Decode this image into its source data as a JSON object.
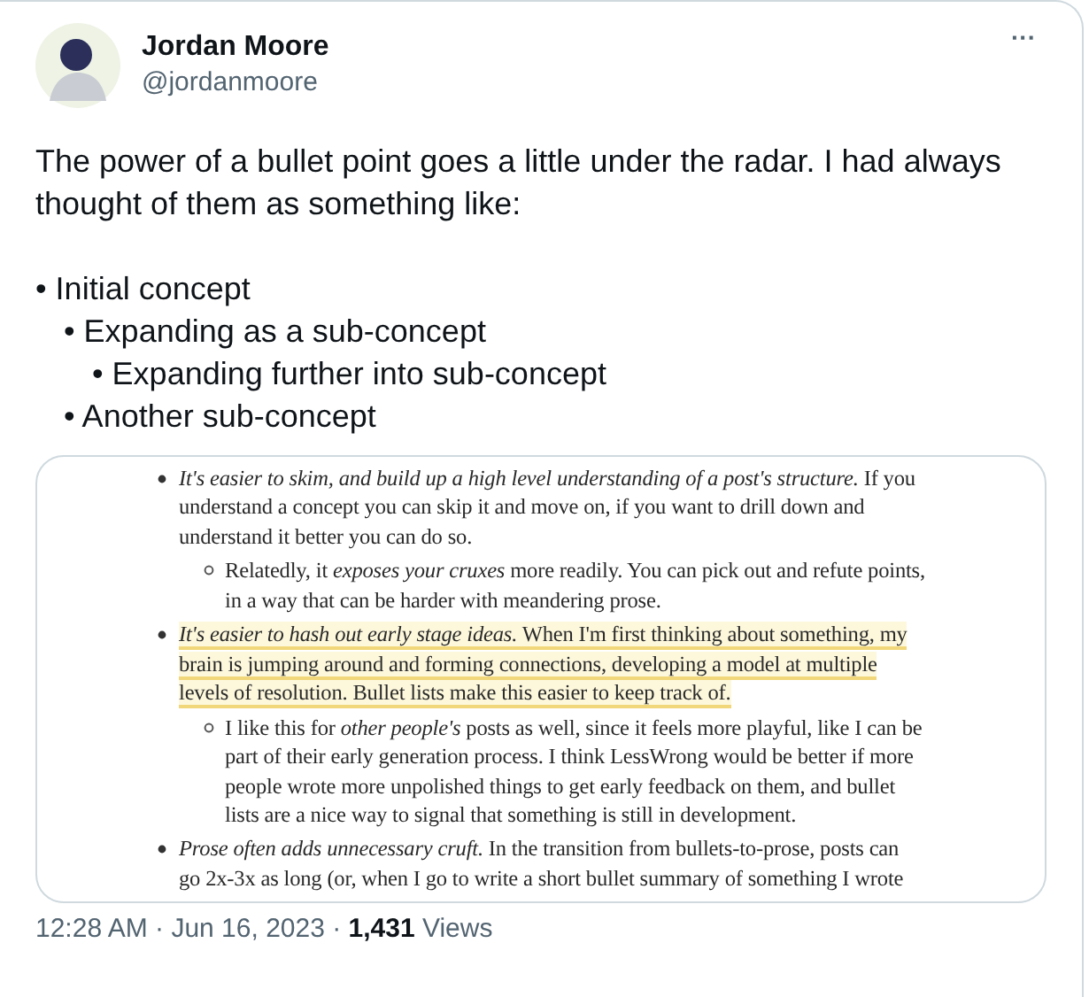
{
  "author": {
    "name": "Jordan Moore",
    "handle": "@jordanmoore"
  },
  "more_button": "···",
  "text": "The power of a bullet point goes a little under the radar. I had always thought of them as something like:",
  "bullets": [
    {
      "text": "• Initial concept",
      "children": [
        {
          "text": "• Expanding as a sub-concept",
          "children": [
            {
              "text": "• Expanding further into sub-concept"
            }
          ]
        },
        {
          "text": "• Another sub-concept"
        }
      ]
    }
  ],
  "attached_document": {
    "items": [
      {
        "text": "*It's easier to skim, and build up a high level understanding of a post's structure.* If you understand a concept you can skip it and move on, if you want to drill down and understand it better you can do so.",
        "highlighted": false,
        "children": [
          {
            "text": "Relatedly, it *exposes your cruxes* more readily. You can pick out and refute points, in a way that can be harder with meandering prose.",
            "highlighted": false
          }
        ]
      },
      {
        "text": "*It's easier to hash out early stage ideas.* When I'm first thinking about something, my brain is jumping around and forming connections, developing a model at multiple levels of resolution. Bullet lists make this easier to keep track of.",
        "highlighted": true,
        "children": [
          {
            "text": "I like this for *other people's* posts as well, since it feels more playful, like I can be part of their early generation process. I think LessWrong would be better if more people wrote more unpolished things to get early feedback on them, and bullet lists are a nice way to signal that something is still in development.",
            "highlighted": false
          }
        ]
      },
      {
        "text": "*Prose often adds unnecessary cruft.* In the transition from bullets-to-prose, posts can go 2x-3x as long (or, when I go to write a short bullet summary of something I wrote",
        "highlighted": false
      }
    ]
  },
  "footer": "12:28 AM · Jun 16, 2023 · **1,431** Views"
}
